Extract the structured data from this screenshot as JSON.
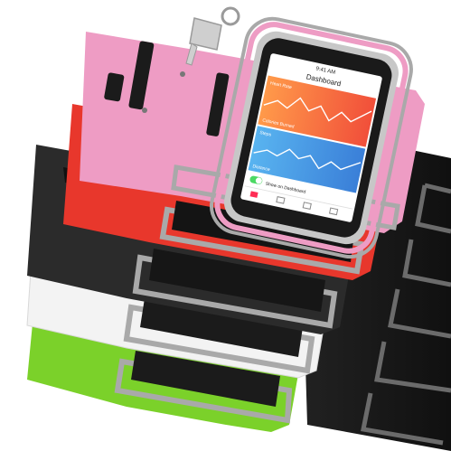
{
  "product": {
    "armband_colors": [
      {
        "name": "pink",
        "hex": "#ee9cc4"
      },
      {
        "name": "red",
        "hex": "#e8372c"
      },
      {
        "name": "black",
        "hex": "#2b2b2b"
      },
      {
        "name": "white",
        "hex": "#f3f3f3"
      },
      {
        "name": "green",
        "hex": "#7bd12a"
      }
    ],
    "reflective_trim_hex": "#a9a9a9",
    "strap_hex": "#1b1b1b"
  },
  "phone_screen": {
    "status_time": "9:41 AM",
    "title": "Dashboard",
    "cards": [
      {
        "label": "Heart Rate",
        "color": "#f36b3a"
      },
      {
        "label": "Calories Burned",
        "color": "#f36b3a"
      },
      {
        "label": "Steps",
        "color": "#3b8fe0"
      },
      {
        "label": "Distance",
        "color": "#3b8fe0"
      }
    ],
    "show_on_dashboard_label": "Show on Dashboard",
    "tab_icons": [
      "heart-icon",
      "health-data-icon",
      "sources-icon",
      "medical-id-icon"
    ]
  }
}
